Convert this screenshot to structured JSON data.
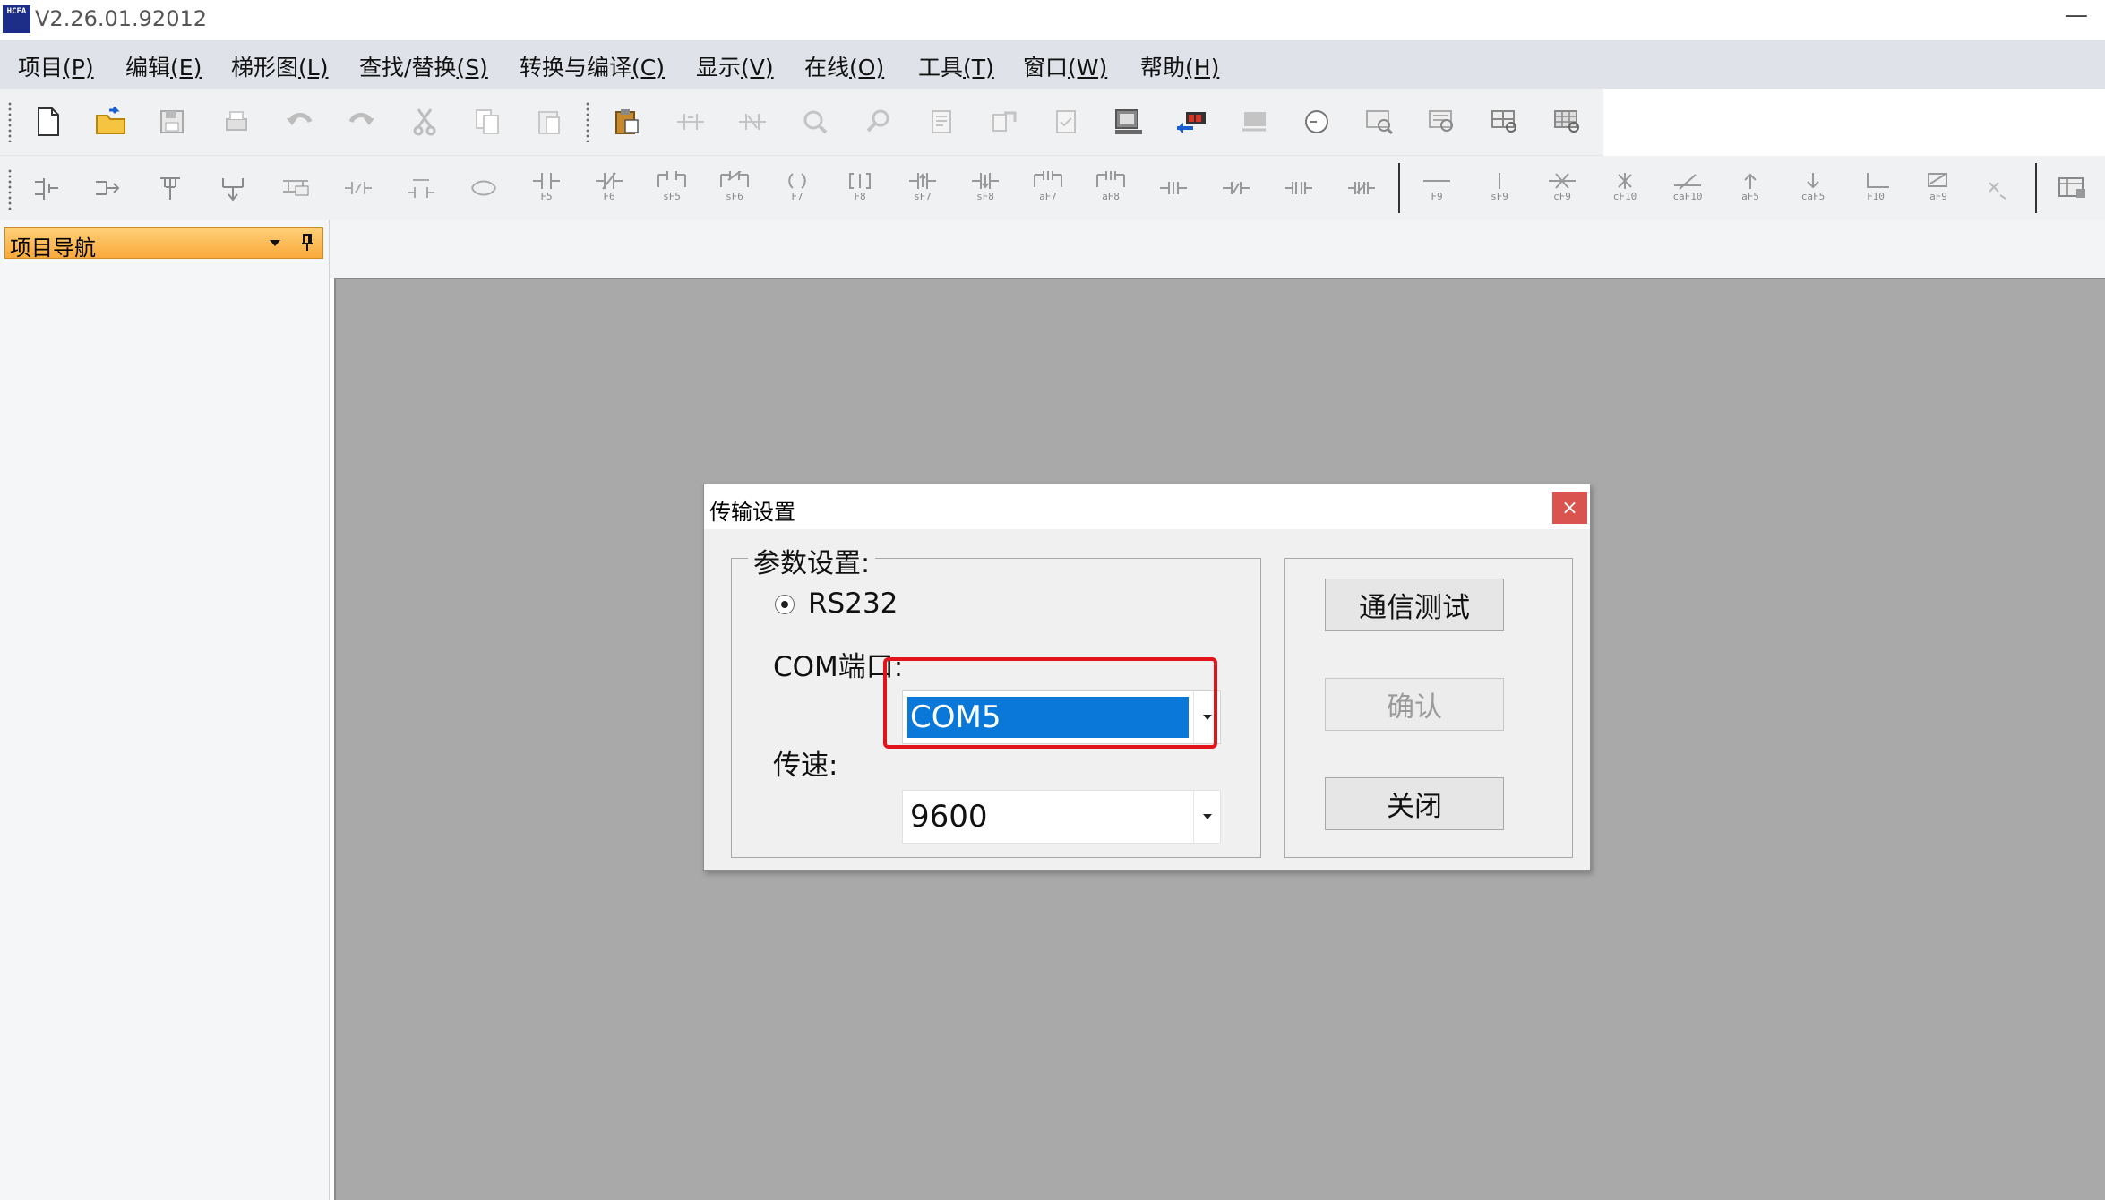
{
  "app": {
    "logo_text": "HCFA",
    "title": "V2.26.01.92012",
    "minimize_glyph": "—"
  },
  "menu": [
    {
      "label": "项目",
      "accel": "(P)"
    },
    {
      "label": "编辑",
      "accel": "(E)"
    },
    {
      "label": "梯形图",
      "accel": "(L)"
    },
    {
      "label": "查找/替换",
      "accel": "(S)"
    },
    {
      "label": "转换与编译",
      "accel": "(C)"
    },
    {
      "label": "显示",
      "accel": "(V)"
    },
    {
      "label": "在线",
      "accel": "(O)"
    },
    {
      "label": "工具",
      "accel": "(T)"
    },
    {
      "label": "窗口",
      "accel": "(W)"
    },
    {
      "label": "帮助",
      "accel": "(H)"
    }
  ],
  "toolbar2_labels": {
    "f5": "F5",
    "f6": "F6",
    "sf5": "sF5",
    "sf6": "sF6",
    "f7": "F7",
    "f8": "F8",
    "sf7": "sF7",
    "sf8": "sF8",
    "af7": "aF7",
    "af8": "aF8",
    "f9": "F9",
    "sf9": "sF9",
    "cf9": "cF9",
    "cf10": "cF10",
    "caf10": "caF10",
    "af5": "aF5",
    "caf5": "caF5",
    "f10": "F10",
    "af9": "aF9"
  },
  "nav": {
    "title": "项目导航"
  },
  "dialog": {
    "title": "传输设置",
    "close_glyph": "×",
    "params_legend": "参数设置:",
    "rs232_label": "RS232",
    "com_label": "COM端口:",
    "com_value": "COM5",
    "speed_label": "传速:",
    "speed_value": "9600",
    "btn_test": "通信测试",
    "btn_confirm": "确认",
    "btn_close": "关闭"
  },
  "colors": {
    "selection_blue": "#0a78d8",
    "highlight_red": "#e0141a",
    "nav_header_orange": "#f9a93a",
    "workspace_gray": "#a9a9a9"
  }
}
